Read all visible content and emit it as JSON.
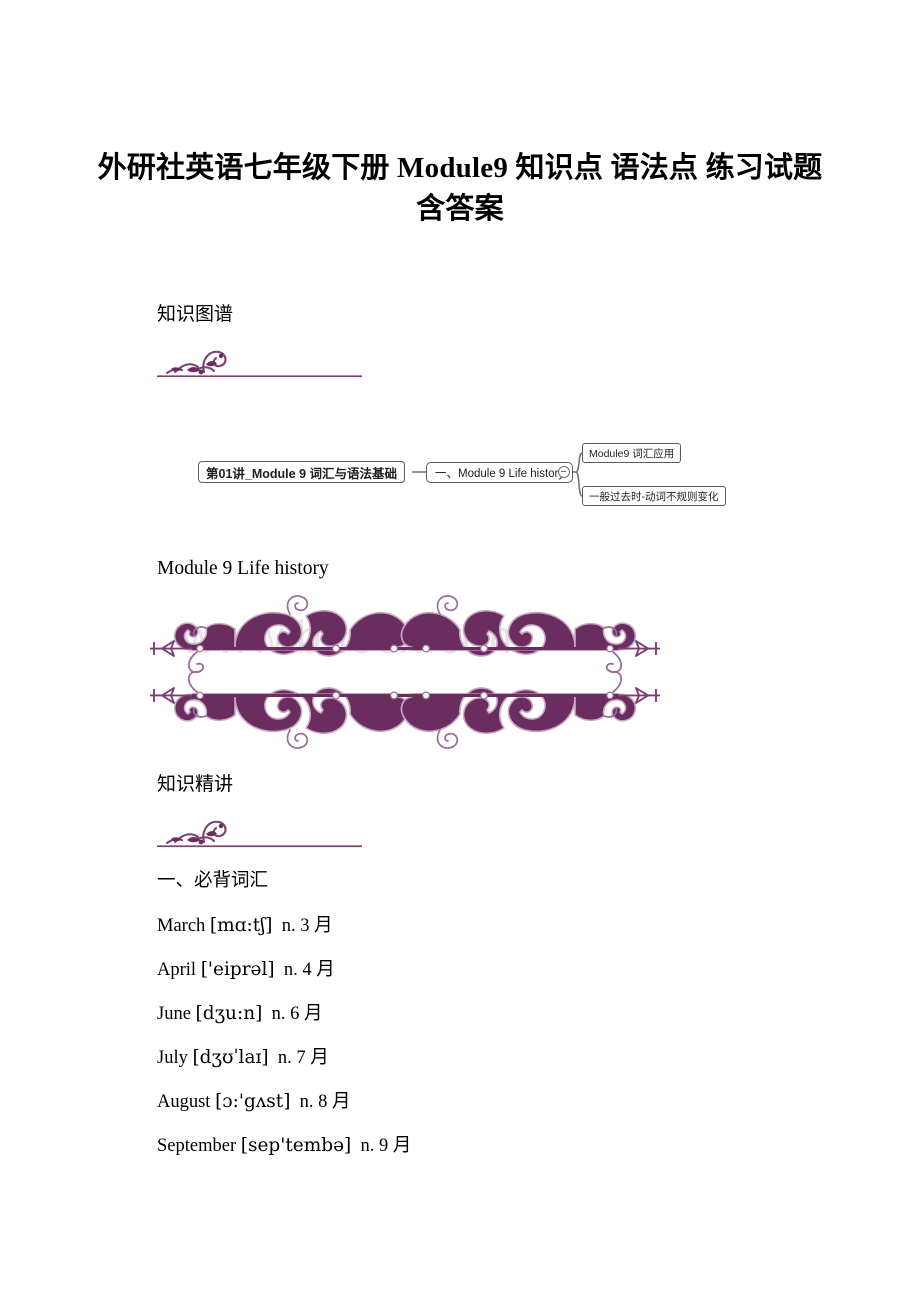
{
  "document": {
    "title": "外研社英语七年级下册 Module9 知识点 语法点 练习试题含答案",
    "watermark": "www.bdocx.com",
    "accent_color": "#6B2C5F",
    "text_color": "#000000"
  },
  "sections": [
    {
      "heading": "知识图谱",
      "divider_icon": "floral-flourish-divider"
    },
    {
      "heading": "知识精讲",
      "divider_icon": "floral-flourish-divider"
    }
  ],
  "mindmap": {
    "root": "第01讲_Module 9 词汇与语法基础",
    "branch": "一、Module 9 Life history",
    "toggle_icon": "collapse-minus-icon",
    "leaves": [
      "Module9 词汇应用",
      "一般过去时-动词不规则变化"
    ]
  },
  "module_heading": "Module 9 Life history",
  "vocabulary": {
    "heading": "一、必背词汇",
    "entries": [
      {
        "word": "March",
        "ipa": "[mɑ:tʃ]",
        "pos": "n.",
        "meaning": "3 月"
      },
      {
        "word": "April",
        "ipa": "['eiprəl]",
        "pos": "n.",
        "meaning": "4 月"
      },
      {
        "word": "June",
        "ipa": "[dʒu:n]",
        "pos": "n.",
        "meaning": "6 月"
      },
      {
        "word": "July",
        "ipa": "[dʒʊˈlaɪ]",
        "pos": "n.",
        "meaning": "7 月"
      },
      {
        "word": "August",
        "ipa": "[ɔ:'gʌst]",
        "pos": "n.",
        "meaning": "8 月"
      },
      {
        "word": "September",
        "ipa": "[sep'tembə]",
        "pos": "n.",
        "meaning": "9 月"
      }
    ]
  }
}
